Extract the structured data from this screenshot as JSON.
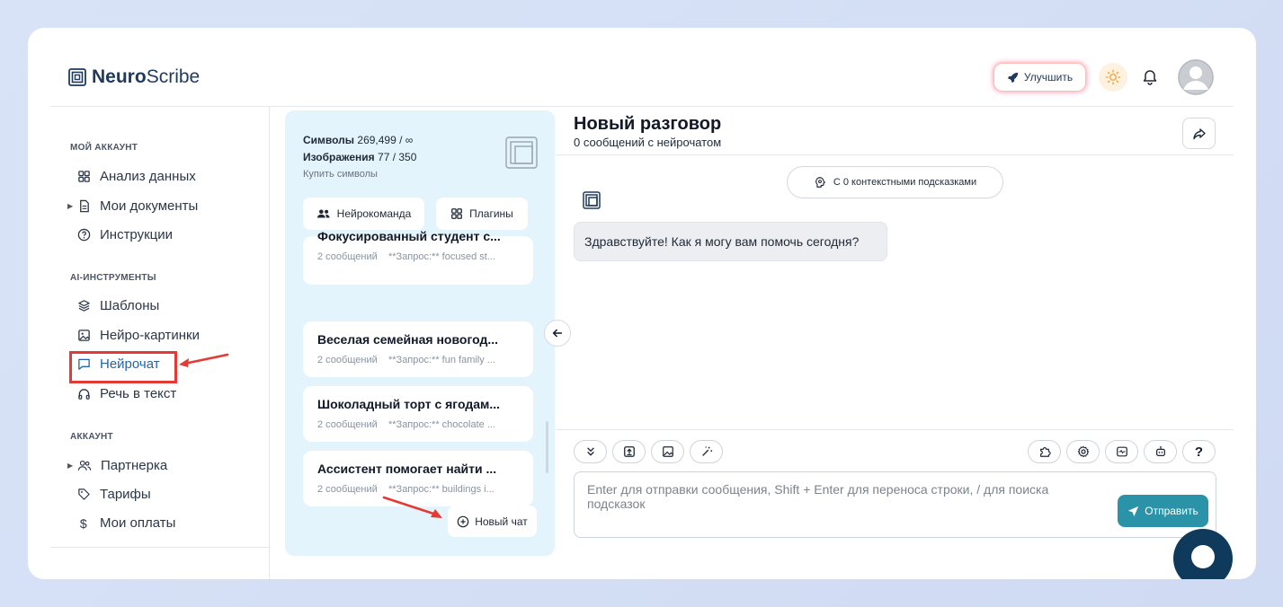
{
  "brand": {
    "bold": "Neuro",
    "light": "Scribe"
  },
  "header": {
    "upgrade_label": "Улучшить"
  },
  "sidebar": {
    "sections": [
      {
        "title": "МОЙ АККАУНТ"
      },
      {
        "title": "AI-ИНСТРУМЕНТЫ"
      },
      {
        "title": "АККАУНТ"
      }
    ],
    "items": [
      {
        "label": "Анализ данных",
        "icon": "grid-icon"
      },
      {
        "label": "Мои документы",
        "icon": "document-icon"
      },
      {
        "label": "Инструкции",
        "icon": "help-circle-icon"
      },
      {
        "label": "Шаблоны",
        "icon": "layers-icon"
      },
      {
        "label": "Нейро-картинки",
        "icon": "image-icon"
      },
      {
        "label": "Нейрочат",
        "icon": "chat-icon",
        "active": true
      },
      {
        "label": "Речь в текст",
        "icon": "headphones-icon"
      },
      {
        "label": "Партнерка",
        "icon": "users-icon"
      },
      {
        "label": "Тарифы",
        "icon": "tag-icon"
      },
      {
        "label": "Мои оплаты",
        "icon": "dollar-icon"
      }
    ]
  },
  "panel": {
    "symbols_label": "Символы",
    "symbols_value": "269,499 / ∞",
    "images_label": "Изображения",
    "images_value": "77 / 350",
    "buy_label": "Купить символы",
    "team_button": "Нейрокоманда",
    "plugins_button": "Плагины",
    "chats": [
      {
        "title": "Фокусированный студент с...",
        "count": "2 сообщений",
        "preview": "**Запрос:** focused st..."
      },
      {
        "title": "Веселая семейная новогод...",
        "count": "2 сообщений",
        "preview": "**Запрос:** fun family ..."
      },
      {
        "title": "Шоколадный торт с ягодам...",
        "count": "2 сообщений",
        "preview": "**Запрос:** chocolate ..."
      },
      {
        "title": "Ассистент помогает найти ...",
        "count": "2 сообщений",
        "preview": "**Запрос:** buildings i..."
      }
    ],
    "new_chat_label": "Новый чат"
  },
  "main": {
    "title": "Новый разговор",
    "subtitle": "0 сообщений с нейрочатом",
    "context_label": "С 0 контекстными подсказками",
    "greeting": "Здравствуйте! Как я могу вам помочь сегодня?",
    "input_placeholder": "Enter для отправки сообщения, Shift + Enter для переноса строки, / для поиска подсказок",
    "send_label": "Отправить",
    "help_label": "?"
  },
  "colors": {
    "accent": "#2a93a7",
    "active_nav": "#2563a8",
    "highlight": "#e53935",
    "panel_bg": "#e3f4fc"
  }
}
